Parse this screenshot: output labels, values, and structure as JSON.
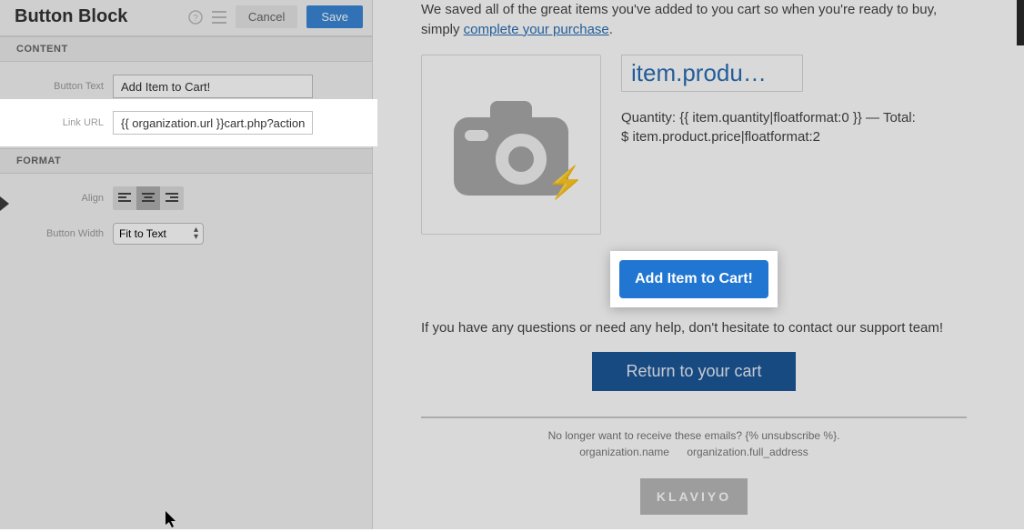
{
  "panel": {
    "title": "Button Block",
    "cancel": "Cancel",
    "save": "Save",
    "sections": {
      "content": "CONTENT",
      "format": "FORMAT"
    },
    "fields": {
      "button_text_label": "Button Text",
      "button_text_value": "Add Item to Cart!",
      "link_url_label": "Link URL",
      "link_url_value": "{{ organization.url }}cart.php?action=a",
      "align_label": "Align",
      "button_width_label": "Button Width",
      "button_width_value": "Fit to Text"
    }
  },
  "preview": {
    "saved_line_pre": "We saved all of the great items you've added to you cart so when you're ready to buy, simply ",
    "saved_line_link": "complete your purchase",
    "saved_line_post": ".",
    "product_title": "item.produ…",
    "product_meta_1": "Quantity: {{ item.quantity|floatformat:0 }} — Total:",
    "product_meta_2": "$ item.product.price|floatformat:2",
    "cta": "Add Item to Cart!",
    "help_line": "If you have any questions or need any help, don't hesitate to contact our support team!",
    "return": "Return to your cart",
    "unsub": "No longer want to receive these emails? {% unsubscribe %}.",
    "org_name": "organization.name",
    "org_addr": "organization.full_address",
    "brand": "KLAVIYO"
  }
}
